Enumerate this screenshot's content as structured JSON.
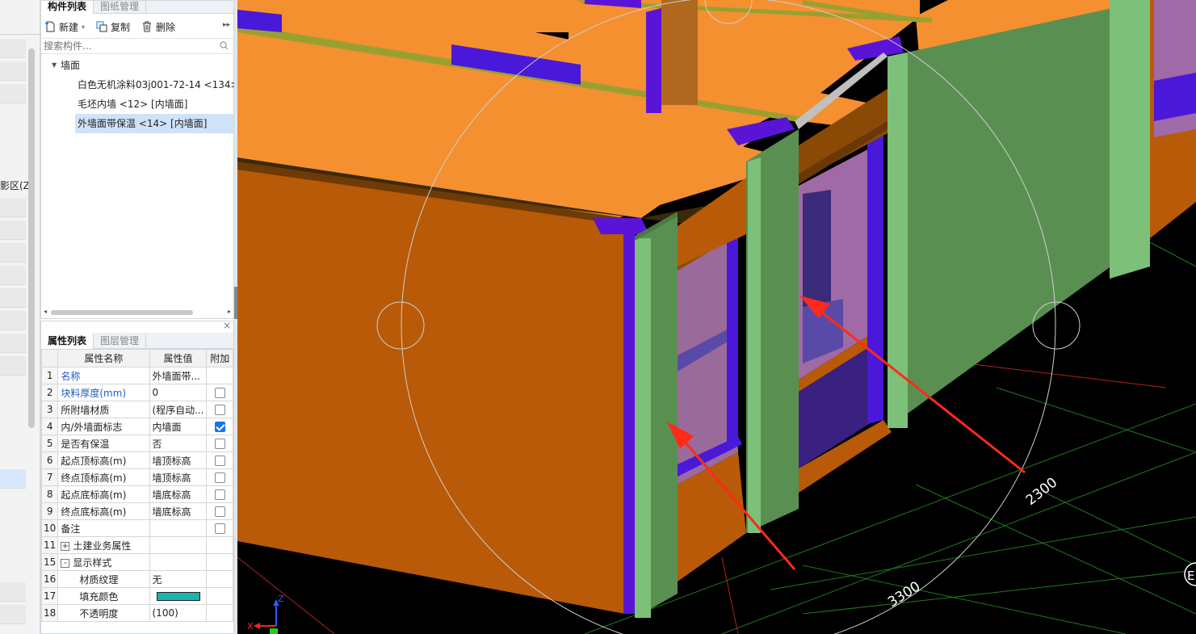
{
  "left_strip": {
    "partial_text": "影区(Z"
  },
  "component_panel": {
    "tabs": [
      "构件列表",
      "图纸管理"
    ],
    "toolbar": {
      "new_label": "新建",
      "copy_label": "复制",
      "delete_label": "删除"
    },
    "search": {
      "placeholder": "搜索构件..."
    },
    "tree": {
      "root_label": "墙面",
      "items": [
        "白色无机涂料03j001-72-14 <134>",
        "毛坯内墙 <12> [内墙面]",
        "外墙面带保温 <14> [内墙面]"
      ],
      "selected_index": 2
    }
  },
  "property_panel": {
    "tabs": [
      "属性列表",
      "图层管理"
    ],
    "headers": [
      "属性名称",
      "属性值",
      "附加"
    ],
    "rows": [
      {
        "num": "1",
        "name": "名称",
        "value": "外墙面带...",
        "checkbox": "none",
        "blue": true
      },
      {
        "num": "2",
        "name": "块料厚度(mm)",
        "value": "0",
        "checkbox": "off",
        "blue": true
      },
      {
        "num": "3",
        "name": "所附墙材质",
        "value": "(程序自动...",
        "checkbox": "off",
        "blue": false
      },
      {
        "num": "4",
        "name": "内/外墙面标志",
        "value": "内墙面",
        "checkbox": "on",
        "blue": false
      },
      {
        "num": "5",
        "name": "是否有保温",
        "value": "否",
        "checkbox": "off",
        "blue": false
      },
      {
        "num": "6",
        "name": "起点顶标高(m)",
        "value": "墙顶标高",
        "checkbox": "off",
        "blue": false
      },
      {
        "num": "7",
        "name": "终点顶标高(m)",
        "value": "墙顶标高",
        "checkbox": "off",
        "blue": false
      },
      {
        "num": "8",
        "name": "起点底标高(m)",
        "value": "墙底标高",
        "checkbox": "off",
        "blue": false
      },
      {
        "num": "9",
        "name": "终点底标高(m)",
        "value": "墙底标高",
        "checkbox": "off",
        "blue": false
      },
      {
        "num": "10",
        "name": "备注",
        "value": "",
        "checkbox": "off",
        "blue": false
      },
      {
        "num": "11",
        "name": "土建业务属性",
        "value": "",
        "checkbox": "none",
        "blue": false,
        "expander": "+"
      },
      {
        "num": "15",
        "name": "显示样式",
        "value": "",
        "checkbox": "none",
        "blue": false,
        "expander": "-"
      },
      {
        "num": "16",
        "name": "材质纹理",
        "value": "无",
        "checkbox": "none",
        "blue": false,
        "indent": true
      },
      {
        "num": "17",
        "name": "填充颜色",
        "value": "",
        "checkbox": "none",
        "blue": false,
        "indent": true,
        "swatch": true
      },
      {
        "num": "18",
        "name": "不透明度",
        "value": "(100)",
        "checkbox": "none",
        "blue": false,
        "indent": true
      }
    ],
    "fill_color": "#1ab3ad"
  },
  "viewport": {
    "dimensions": [
      "2300",
      "3300"
    ],
    "axis_labels": {
      "x": "X",
      "z": "Z"
    },
    "edge_label": "E"
  },
  "colors": {
    "wall_orange": "#b85a08",
    "roof_orange": "#f49030",
    "column_green": "#5a8f52",
    "purple": "#5a14d8",
    "arrow_red": "#ff2a1a"
  }
}
